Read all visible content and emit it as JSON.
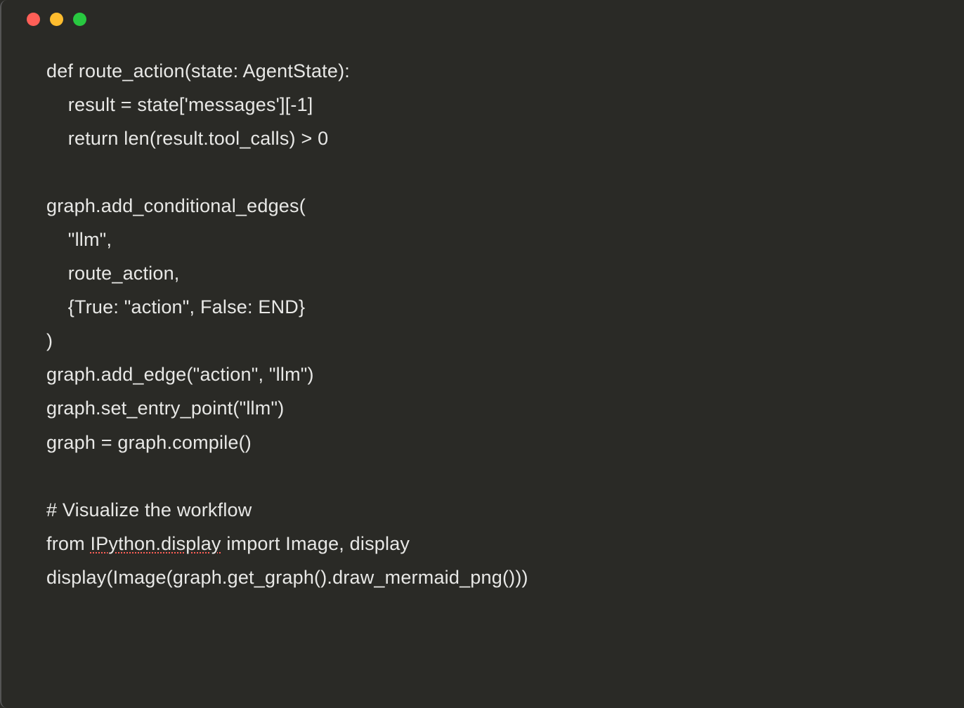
{
  "code": {
    "lines": [
      "def route_action(state: AgentState):",
      "    result = state['messages'][-1]",
      "    return len(result.tool_calls) > 0",
      "",
      "graph.add_conditional_edges(",
      "    \"llm\",",
      "    route_action,",
      "    {True: \"action\", False: END}",
      ")",
      "graph.add_edge(\"action\", \"llm\")",
      "graph.set_entry_point(\"llm\")",
      "graph = graph.compile()",
      "",
      "# Visualize the workflow",
      "from IPython.display import Image, display",
      "display(Image(graph.get_graph().draw_mermaid_png()))"
    ],
    "spell_line_prefix": "from ",
    "spell_word": "IPython.display",
    "spell_line_suffix": " import Image, display"
  },
  "window": {
    "traffic_lights": [
      "close",
      "minimize",
      "maximize"
    ]
  }
}
